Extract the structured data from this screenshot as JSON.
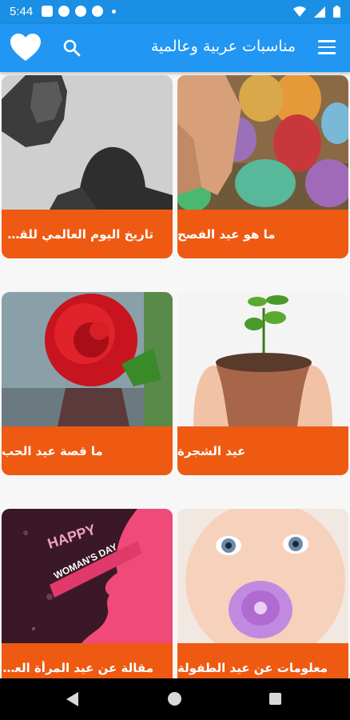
{
  "status_bar": {
    "time": "5:44"
  },
  "app_bar": {
    "title": "مناسبات عربية وعالمية"
  },
  "colors": {
    "app_bar": "#2196f3",
    "status_bar": "#1a8fe3",
    "card_label": "#ee5a12"
  },
  "icons": {
    "menu": "hamburger-menu-icon",
    "search": "search-icon",
    "favorite": "heart-icon"
  },
  "cards": [
    {
      "label": "ما هو عيد الفصح"
    },
    {
      "label": "تاريخ اليوم العالمي للقضاء على العنف ضد المرأة"
    },
    {
      "label": "عيد الشجرة"
    },
    {
      "label": "ما قصة عيد الحب"
    },
    {
      "label": "معلومات عن عيد الطفولة"
    },
    {
      "label": "مقالة عن عيد المرأة العالمي"
    }
  ],
  "womens_day_text": {
    "line1": "HAPPY",
    "line2": "WOMAN'S DAY"
  }
}
